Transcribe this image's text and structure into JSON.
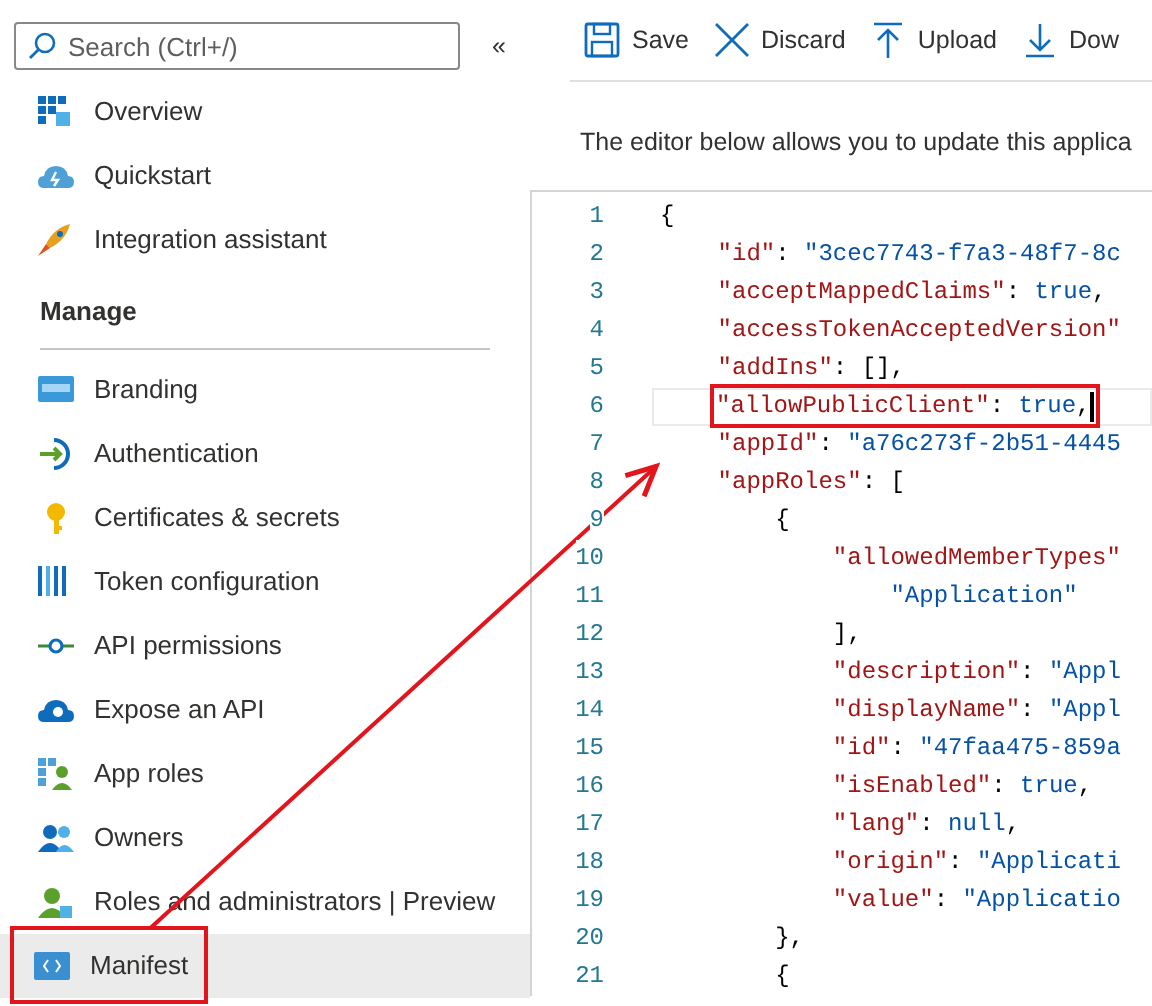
{
  "sidebar": {
    "search": {
      "placeholder": "Search (Ctrl+/)"
    },
    "collapse": "«",
    "items": [
      {
        "label": "Overview",
        "selected": false,
        "highlighted": false
      },
      {
        "label": "Quickstart",
        "selected": false,
        "highlighted": false
      },
      {
        "label": "Integration assistant",
        "selected": false,
        "highlighted": false
      }
    ],
    "section": {
      "title": "Manage",
      "items": [
        {
          "label": "Branding",
          "selected": false,
          "highlighted": false
        },
        {
          "label": "Authentication",
          "selected": false,
          "highlighted": false
        },
        {
          "label": "Certificates & secrets",
          "selected": false,
          "highlighted": false
        },
        {
          "label": "Token configuration",
          "selected": false,
          "highlighted": false
        },
        {
          "label": "API permissions",
          "selected": false,
          "highlighted": false
        },
        {
          "label": "Expose an API",
          "selected": false,
          "highlighted": false
        },
        {
          "label": "App roles",
          "selected": false,
          "highlighted": false
        },
        {
          "label": "Owners",
          "selected": false,
          "highlighted": false
        },
        {
          "label": "Roles and administrators | Preview",
          "selected": false,
          "highlighted": false
        },
        {
          "label": "Manifest",
          "selected": true,
          "highlighted": true
        }
      ]
    }
  },
  "toolbar": [
    "Save",
    "Discard",
    "Upload",
    "Dow"
  ],
  "description": "The editor below allows you to update this applica",
  "editor": {
    "lines": [
      {
        "number": "1",
        "tokens": [
          {
            "kind": "punct",
            "text": "{"
          }
        ]
      },
      {
        "number": "2",
        "tokens": [
          {
            "kind": "key",
            "text": "    \"id\""
          },
          {
            "kind": "punct",
            "text": ": "
          },
          {
            "kind": "string",
            "text": "\"3cec7743-f7a3-48f7-8c"
          }
        ]
      },
      {
        "number": "3",
        "tokens": [
          {
            "kind": "key",
            "text": "    \"acceptMappedClaims\""
          },
          {
            "kind": "punct",
            "text": ": "
          },
          {
            "kind": "literal",
            "text": "true"
          },
          {
            "kind": "punct",
            "text": ","
          }
        ]
      },
      {
        "number": "4",
        "tokens": [
          {
            "kind": "key",
            "text": "    \"accessTokenAcceptedVersion\""
          }
        ]
      },
      {
        "number": "5",
        "tokens": [
          {
            "kind": "key",
            "text": "    \"addIns\""
          },
          {
            "kind": "punct",
            "text": ": [],"
          }
        ]
      },
      {
        "number": "6",
        "highlighted": true,
        "cursor": true,
        "tokens": [
          {
            "kind": "key",
            "text": "\"allowPublicClient\""
          },
          {
            "kind": "punct",
            "text": ": "
          },
          {
            "kind": "literal",
            "text": "true"
          },
          {
            "kind": "punct",
            "text": ","
          }
        ]
      },
      {
        "number": "7",
        "arrow_target": true,
        "tokens": [
          {
            "kind": "key",
            "text": "    \"appId\""
          },
          {
            "kind": "punct",
            "text": ": "
          },
          {
            "kind": "string",
            "text": "\"a76c273f-2b51-4445"
          }
        ]
      },
      {
        "number": "8",
        "tokens": [
          {
            "kind": "key",
            "text": "    \"appRoles\""
          },
          {
            "kind": "punct",
            "text": ": ["
          }
        ]
      },
      {
        "number": "9",
        "tokens": [
          {
            "kind": "punct",
            "text": "        {"
          }
        ]
      },
      {
        "number": "10",
        "tokens": [
          {
            "kind": "key",
            "text": "            \"allowedMemberTypes\""
          }
        ]
      },
      {
        "number": "11",
        "tokens": [
          {
            "kind": "string",
            "text": "                \"Application\""
          }
        ]
      },
      {
        "number": "12",
        "tokens": [
          {
            "kind": "punct",
            "text": "            ],"
          }
        ]
      },
      {
        "number": "13",
        "tokens": [
          {
            "kind": "key",
            "text": "            \"description\""
          },
          {
            "kind": "punct",
            "text": ": "
          },
          {
            "kind": "string",
            "text": "\"Appl"
          }
        ]
      },
      {
        "number": "14",
        "tokens": [
          {
            "kind": "key",
            "text": "            \"displayName\""
          },
          {
            "kind": "punct",
            "text": ": "
          },
          {
            "kind": "string",
            "text": "\"Appl"
          }
        ]
      },
      {
        "number": "15",
        "tokens": [
          {
            "kind": "key",
            "text": "            \"id\""
          },
          {
            "kind": "punct",
            "text": ": "
          },
          {
            "kind": "string",
            "text": "\"47faa475-859a"
          }
        ]
      },
      {
        "number": "16",
        "tokens": [
          {
            "kind": "key",
            "text": "            \"isEnabled\""
          },
          {
            "kind": "punct",
            "text": ": "
          },
          {
            "kind": "literal",
            "text": "true"
          },
          {
            "kind": "punct",
            "text": ","
          }
        ]
      },
      {
        "number": "17",
        "tokens": [
          {
            "kind": "key",
            "text": "            \"lang\""
          },
          {
            "kind": "punct",
            "text": ": "
          },
          {
            "kind": "literal",
            "text": "null"
          },
          {
            "kind": "punct",
            "text": ","
          }
        ]
      },
      {
        "number": "18",
        "tokens": [
          {
            "kind": "key",
            "text": "            \"origin\""
          },
          {
            "kind": "punct",
            "text": ": "
          },
          {
            "kind": "string",
            "text": "\"Applicati"
          }
        ]
      },
      {
        "number": "19",
        "tokens": [
          {
            "kind": "key",
            "text": "            \"value\""
          },
          {
            "kind": "punct",
            "text": ": "
          },
          {
            "kind": "string",
            "text": "\"Applicatio"
          }
        ]
      },
      {
        "number": "20",
        "tokens": [
          {
            "kind": "punct",
            "text": "        },"
          }
        ]
      },
      {
        "number": "21",
        "tokens": [
          {
            "kind": "punct",
            "text": "        {"
          }
        ]
      }
    ]
  },
  "annotation_arrow": true
}
